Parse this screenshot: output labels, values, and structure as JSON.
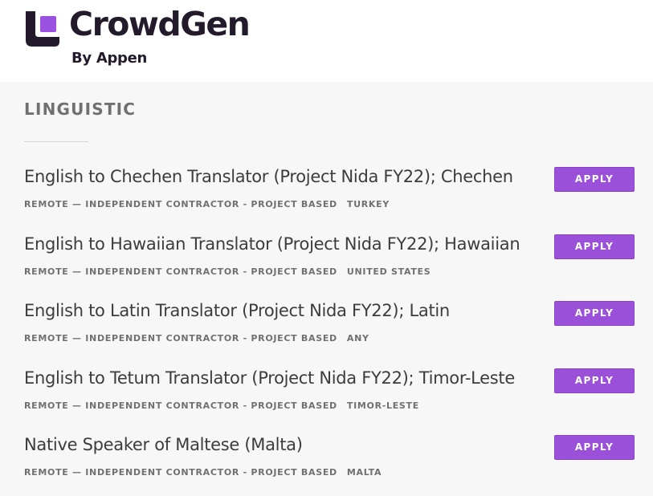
{
  "brand": {
    "name": "CrowdGen",
    "tagline": "By Appen",
    "colors": {
      "dark": "#231a2b",
      "accent": "#9b51e0"
    },
    "icon": "crowdgen-logo-icon"
  },
  "section": {
    "title": "LINGUISTIC"
  },
  "apply_label": "APPLY",
  "jobs": [
    {
      "title": "English to Chechen Translator (Project Nida FY22); Chechen",
      "type": "REMOTE — INDEPENDENT CONTRACTOR - PROJECT BASED",
      "location": "TURKEY",
      "action": "APPLY"
    },
    {
      "title": "English to Hawaiian Translator (Project Nida FY22); Hawaiian",
      "type": "REMOTE — INDEPENDENT CONTRACTOR - PROJECT BASED",
      "location": "UNITED STATES",
      "action": "APPLY"
    },
    {
      "title": "English to Latin Translator (Project Nida FY22); Latin",
      "type": "REMOTE — INDEPENDENT CONTRACTOR - PROJECT BASED",
      "location": "ANY",
      "action": "APPLY"
    },
    {
      "title": "English to Tetum Translator (Project Nida FY22); Timor-Leste",
      "type": "REMOTE — INDEPENDENT CONTRACTOR - PROJECT BASED",
      "location": "TIMOR-LESTE",
      "action": "APPLY"
    },
    {
      "title": "Native Speaker of Maltese (Malta)",
      "type": "REMOTE — INDEPENDENT CONTRACTOR - PROJECT BASED",
      "location": "MALTA",
      "action": "APPLY"
    }
  ]
}
